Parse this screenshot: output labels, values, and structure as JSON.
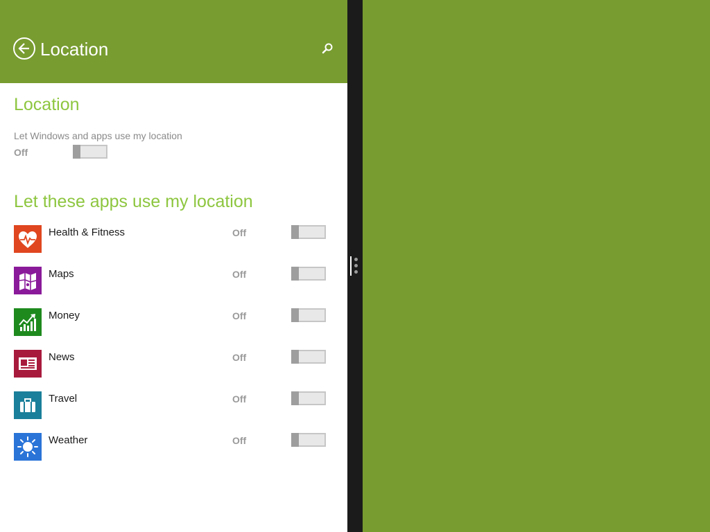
{
  "header": {
    "title": "Location",
    "back_icon": "back-arrow-icon",
    "search_icon": "search-icon",
    "color": "#789c30"
  },
  "location": {
    "section_title": "Location",
    "description": "Let Windows and apps use my location",
    "state": "Off",
    "enabled": false
  },
  "apps_section": {
    "title": "Let these apps use my location",
    "apps": [
      {
        "name": "Health & Fitness",
        "state": "Off",
        "icon": "heart-pulse-icon",
        "color": "#e0461f",
        "enabled": false
      },
      {
        "name": "Maps",
        "state": "Off",
        "icon": "map-icon",
        "color": "#8a1a9a",
        "enabled": false
      },
      {
        "name": "Money",
        "state": "Off",
        "icon": "stock-chart-icon",
        "color": "#1e8a1e",
        "enabled": false
      },
      {
        "name": "News",
        "state": "Off",
        "icon": "newspaper-icon",
        "color": "#a81a3c",
        "enabled": false
      },
      {
        "name": "Travel",
        "state": "Off",
        "icon": "suitcase-icon",
        "color": "#1a7f9a",
        "enabled": false
      },
      {
        "name": "Weather",
        "state": "Off",
        "icon": "sun-icon",
        "color": "#2a74d8",
        "enabled": false
      }
    ]
  },
  "accent_color": "#8dc63f"
}
